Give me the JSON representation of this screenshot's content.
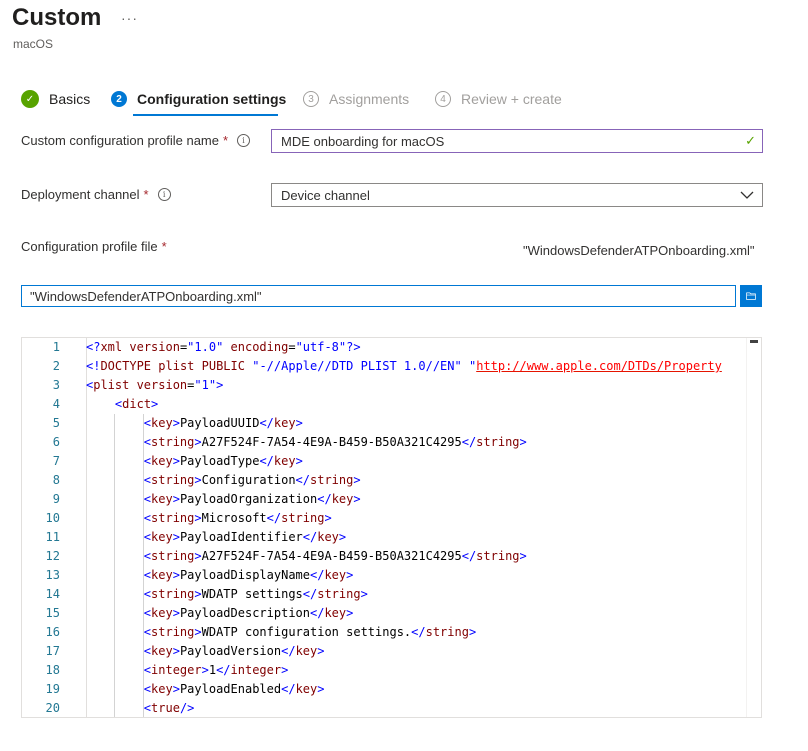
{
  "header": {
    "title": "Custom",
    "more": "···",
    "subtitle": "macOS"
  },
  "steps": [
    {
      "number": "✓",
      "label": "Basics",
      "state": "done"
    },
    {
      "number": "2",
      "label": "Configuration settings",
      "state": "current"
    },
    {
      "number": "3",
      "label": "Assignments",
      "state": "future"
    },
    {
      "number": "4",
      "label": "Review + create",
      "state": "future"
    }
  ],
  "form": {
    "profile_name": {
      "label": "Custom configuration profile name",
      "required": "*",
      "value": "MDE onboarding for macOS"
    },
    "deployment_channel": {
      "label": "Deployment channel",
      "required": "*",
      "value": "Device channel"
    },
    "config_file": {
      "label": "Configuration profile file",
      "required": "*",
      "filename": "\"WindowsDefenderATPOnboarding.xml\"",
      "input_value": "\"WindowsDefenderATPOnboarding.xml\""
    }
  },
  "editor": {
    "line_numbers": [
      "1",
      "2",
      "3",
      "4",
      "5",
      "6",
      "7",
      "8",
      "9",
      "10",
      "11",
      "12",
      "13",
      "14",
      "15",
      "16",
      "17",
      "18",
      "19",
      "20"
    ],
    "lines": [
      "<?xml version=\"1.0\" encoding=\"utf-8\"?>",
      "<!DOCTYPE plist PUBLIC \"-//Apple//DTD PLIST 1.0//EN\" \"http://www.apple.com/DTDs/Property",
      "<plist version=\"1\">",
      "    <dict>",
      "        <key>PayloadUUID</key>",
      "        <string>A27F524F-7A54-4E9A-B459-B50A321C4295</string>",
      "        <key>PayloadType</key>",
      "        <string>Configuration</string>",
      "        <key>PayloadOrganization</key>",
      "        <string>Microsoft</string>",
      "        <key>PayloadIdentifier</key>",
      "        <string>A27F524F-7A54-4E9A-B459-B50A321C4295</string>",
      "        <key>PayloadDisplayName</key>",
      "        <string>WDATP settings</string>",
      "        <key>PayloadDescription</key>",
      "        <string>WDATP configuration settings.</string>",
      "        <key>PayloadVersion</key>",
      "        <integer>1</integer>",
      "        <key>PayloadEnabled</key>",
      "        <true/>"
    ]
  },
  "colors": {
    "accent": "#0078d4",
    "success": "#57a300",
    "required": "#a4262c"
  }
}
